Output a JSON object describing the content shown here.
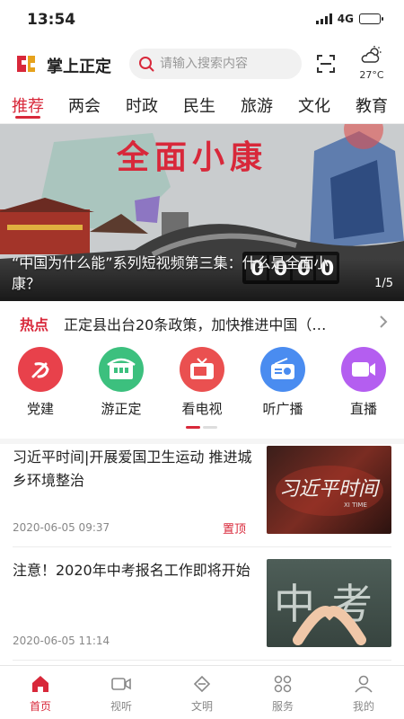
{
  "status_bar": {
    "time": "13:54",
    "network": "4G",
    "battery_level": 0.45
  },
  "header": {
    "app_title": "掌上正定",
    "search_placeholder": "请输入搜索内容",
    "weather_temp": "27°C",
    "brand_color": "#d8283a"
  },
  "tabs": [
    {
      "label": "推荐",
      "active": true
    },
    {
      "label": "两会",
      "active": false
    },
    {
      "label": "时政",
      "active": false
    },
    {
      "label": "民生",
      "active": false
    },
    {
      "label": "旅游",
      "active": false
    },
    {
      "label": "文化",
      "active": false
    },
    {
      "label": "教育",
      "active": false
    }
  ],
  "banner": {
    "headline": "全面小康",
    "caption": "“中国为什么能”系列短视频第三集：什么是全面小康？",
    "pager": "1/5",
    "counter_digits": "0000"
  },
  "hot_news": {
    "label": "热点",
    "text": "正定县出台20条政策，加快推进中国（…"
  },
  "shortcuts": [
    {
      "label": "党建",
      "icon": "party-emblem-icon",
      "color": "#e8414b"
    },
    {
      "label": "游正定",
      "icon": "tour-icon",
      "color": "#3cc07e"
    },
    {
      "label": "看电视",
      "icon": "tv-icon",
      "color": "#ea5050"
    },
    {
      "label": "听广播",
      "icon": "radio-icon",
      "color": "#4a8cf0"
    },
    {
      "label": "直播",
      "icon": "live-video-icon",
      "color": "#b45ef0"
    }
  ],
  "news": [
    {
      "title": "习近平时间|开展爱国卫生运动 推进城乡环境整治",
      "date": "2020-06-05 09:37",
      "pinned_label": "置顶",
      "thumb_text": "习近平时间",
      "thumb_subtext": "XI TIME"
    },
    {
      "title": "注意！2020年中考报名工作即将开始",
      "date": "2020-06-05 11:14",
      "pinned_label": "",
      "thumb_text": "中考"
    }
  ],
  "bottom_nav": [
    {
      "label": "首页",
      "icon": "home-icon",
      "active": true
    },
    {
      "label": "视听",
      "icon": "video-camera-icon",
      "active": false
    },
    {
      "label": "文明",
      "icon": "civilization-icon",
      "active": false
    },
    {
      "label": "服务",
      "icon": "services-grid-icon",
      "active": false
    },
    {
      "label": "我的",
      "icon": "profile-icon",
      "active": false
    }
  ]
}
